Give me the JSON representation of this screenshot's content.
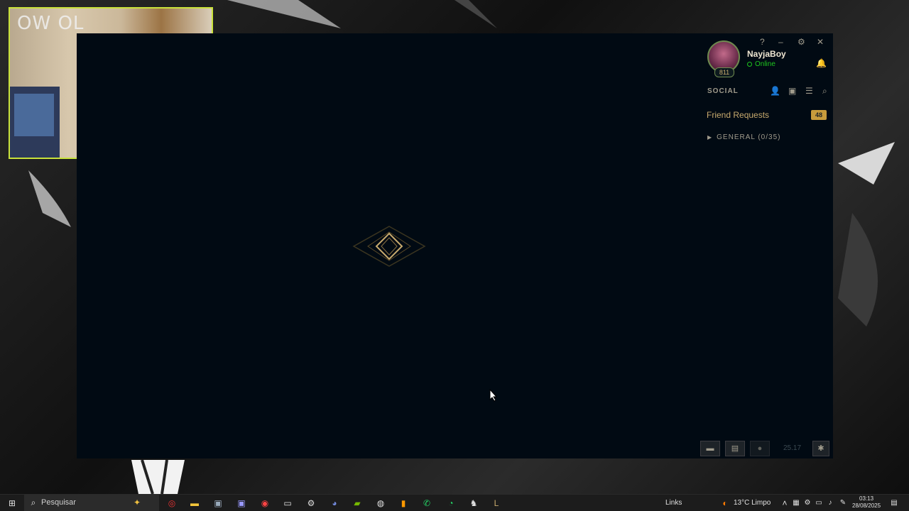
{
  "webcam": {
    "overlay_text": "OW OL"
  },
  "profile": {
    "username": "NayjaBoy",
    "status": "Online",
    "level": "811"
  },
  "window_controls": {
    "help": "?",
    "minimize": "–",
    "settings": "⚙",
    "close": "✕"
  },
  "social": {
    "title": "SOCIAL",
    "friend_requests_label": "Friend Requests",
    "friend_requests_count": "48",
    "group_label": "GENERAL (0/35)"
  },
  "bottom_bar": {
    "version": "25.17"
  },
  "taskbar": {
    "search_placeholder": "Pesquisar",
    "links": "Links",
    "weather": "13°C Limpo",
    "time": "03:13",
    "date": "28/08/2025"
  },
  "colors": {
    "accent_gold": "#c8aa6e",
    "online_green": "#1ec51e",
    "client_bg": "#010a13",
    "badge_gold": "#c89b3c"
  }
}
